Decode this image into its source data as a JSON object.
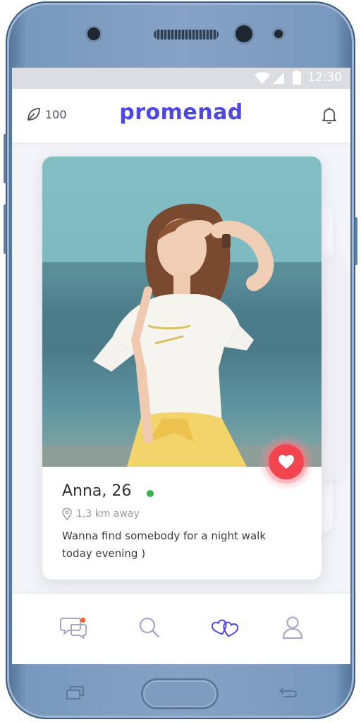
{
  "status_bar": {
    "time": "12:30",
    "icons": [
      "wifi-icon",
      "signal-icon",
      "battery-icon"
    ]
  },
  "app_bar": {
    "coins_icon": "leaf-icon",
    "coins_count": "100",
    "logo": "promenad",
    "notifications_icon": "bell-icon"
  },
  "profile": {
    "name_age": "Anna, 26",
    "online": true,
    "distance": "1,3 km away",
    "bio": "Wanna find somebody for a night walk today evening )",
    "like_icon": "heart-icon"
  },
  "bottom_nav": {
    "active": "matches",
    "items": [
      {
        "id": "chats",
        "icon": "chat-icon",
        "has_notification": true
      },
      {
        "id": "search",
        "icon": "search-icon",
        "has_notification": false
      },
      {
        "id": "matches",
        "icon": "hearts-icon",
        "has_notification": false
      },
      {
        "id": "profile",
        "icon": "user-icon",
        "has_notification": false
      }
    ]
  },
  "colors": {
    "brand": "#4f48e0",
    "like": "#f2454f",
    "online": "#3cb44b",
    "notification_dot": "#ff5a2a",
    "inactive_icon": "#a7a9c7"
  }
}
